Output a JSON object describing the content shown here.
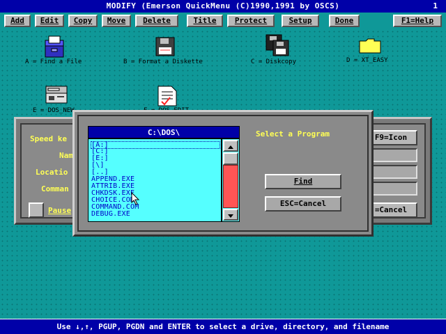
{
  "window": {
    "title": "MODIFY (Emerson QuickMenu (C)1990,1991 by OSCS)",
    "number": "1"
  },
  "menu": {
    "add": "Add",
    "edit": "Edit",
    "copy": "Copy",
    "move": "Move",
    "delete": "Delete",
    "title": "Title",
    "protect": "Protect",
    "setup": "Setup",
    "done": "Done",
    "help": "F1=Help"
  },
  "desktop": {
    "icons": [
      {
        "label": "A = Find a File",
        "icon": "file-box-icon"
      },
      {
        "label": "B = Format a Diskette",
        "icon": "diskette-icon"
      },
      {
        "label": "C = Diskcopy",
        "icon": "diskcopy-icon"
      },
      {
        "label": "D = XT_EASY",
        "icon": "folder-icon"
      },
      {
        "label": "E = DOS_NEW",
        "icon": "computer-icon"
      },
      {
        "label": "F = DOS_EDIT",
        "icon": "document-icon"
      }
    ]
  },
  "modify_dialog": {
    "speed_key_label": "Speed ke",
    "name_label": "Nam",
    "location_label": "Locatio",
    "command_label": "Comman",
    "pause_label": "Pause",
    "icon_button": "F9=Icon",
    "cancel_button": "=Cancel"
  },
  "select_dialog": {
    "path": "C:\\DOS\\",
    "heading": "Select a Program",
    "find_button": "Find",
    "cancel_button": "ESC=Cancel",
    "files": [
      "[A:]",
      "[C:]",
      "[E:]",
      "[\\]",
      "[..]",
      "APPEND.EXE",
      "ATTRIB.EXE",
      "CHKDSK.EXE",
      "CHOICE.COM",
      "COMMAND.COM",
      "DEBUG.EXE"
    ],
    "selected_index": 0
  },
  "status": {
    "text": "Use ↓,↑, PGUP, PGDN and ENTER to select a drive, directory, and filename"
  },
  "colors": {
    "desktop": "#0f9898",
    "title_bar": "#0000a8",
    "list_bg": "#55ffff",
    "list_text": "#0000c8",
    "highlight": "#ffff55",
    "scroll_thumb": "#ff5555"
  }
}
